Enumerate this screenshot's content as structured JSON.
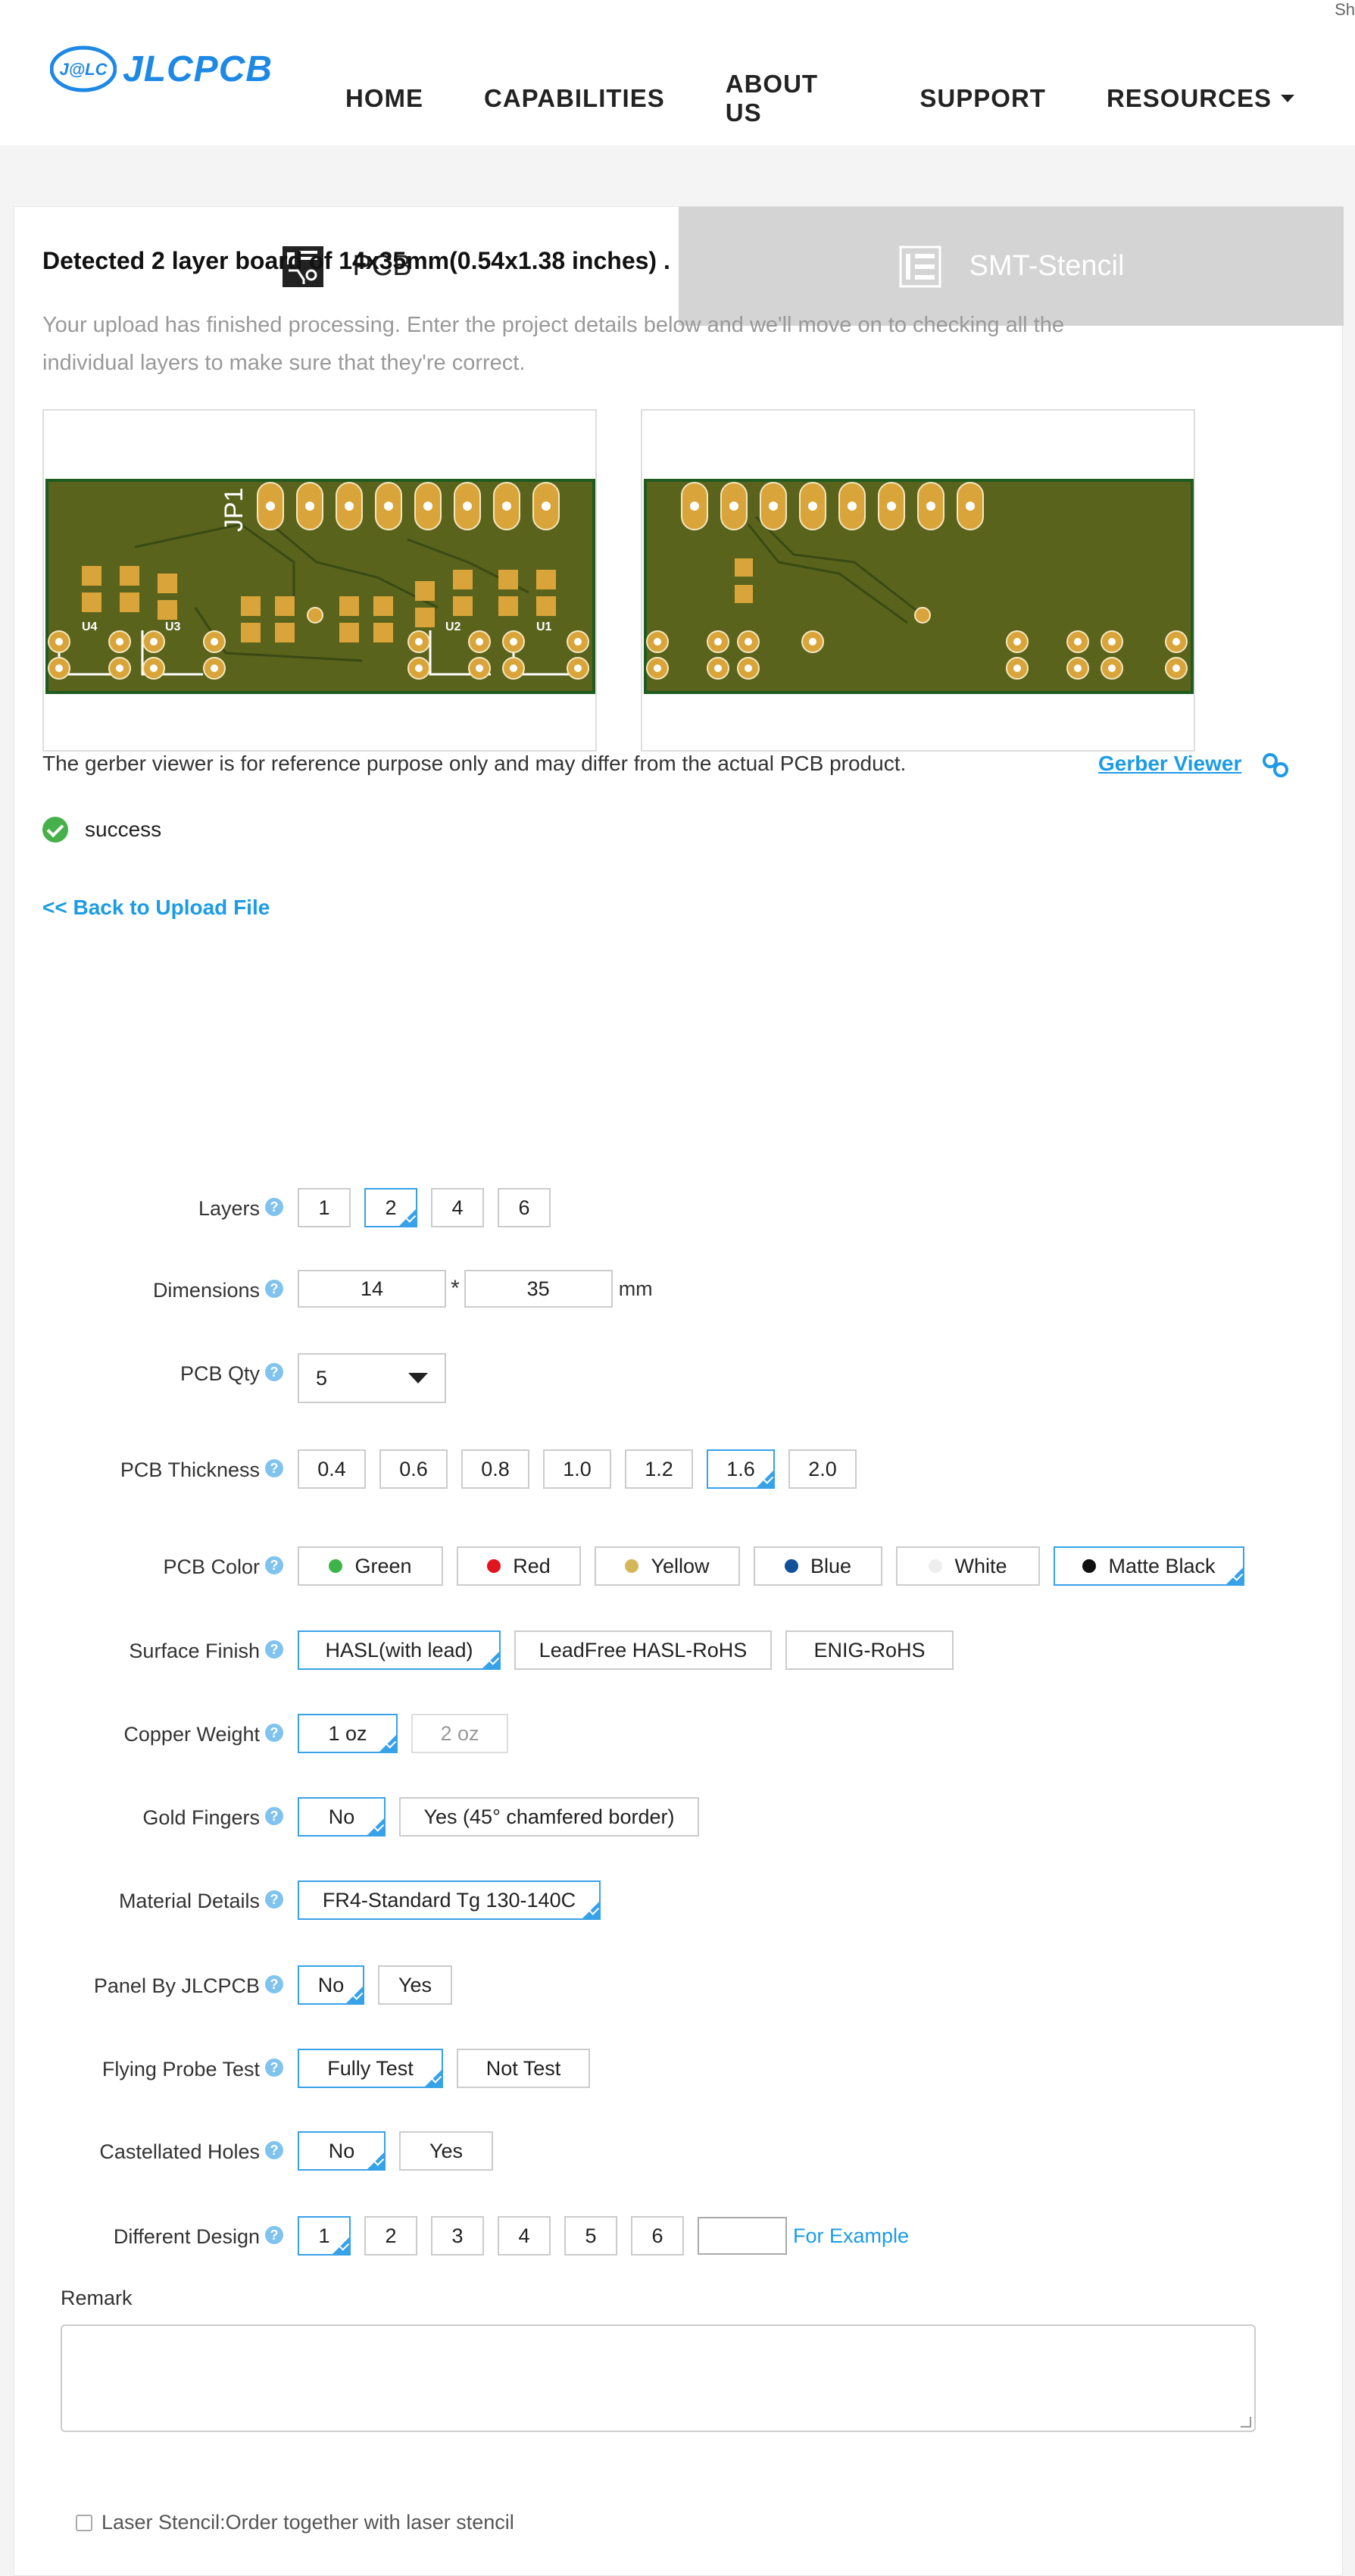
{
  "header": {
    "corner_text": "Sh",
    "logo_badge": "J@LC",
    "logo_word": "JLCPCB",
    "nav": [
      {
        "label": "HOME"
      },
      {
        "label": "CAPABILITIES"
      },
      {
        "label": "ABOUT US"
      },
      {
        "label": "SUPPORT"
      },
      {
        "label": "RESOURCES"
      }
    ]
  },
  "tabs": {
    "pcb": "PCB",
    "smt": "SMT-Stencil"
  },
  "upload": {
    "detected": "Detected 2 layer board of 14x35mm(0.54x1.38 inches) .",
    "description": "Your upload has finished processing. Enter the project details below and we'll move on to checking all the individual layers to make sure that they're correct.",
    "board_labels": {
      "jp": "JP1",
      "u1": "U1",
      "u2": "U2",
      "u3": "U3",
      "u4": "U4"
    },
    "disclaimer": "The gerber viewer is for reference purpose only and may differ from the actual PCB product.",
    "gerber_link": "Gerber Viewer",
    "status": "success",
    "back_link": "<< Back to Upload File"
  },
  "form": {
    "help_glyph": "?",
    "layers": {
      "label": "Layers",
      "options": [
        "1",
        "2",
        "4",
        "6"
      ],
      "selected": "2"
    },
    "dimensions": {
      "label": "Dimensions",
      "width": "14",
      "height": "35",
      "separator": "*",
      "unit": "mm"
    },
    "qty": {
      "label": "PCB Qty",
      "value": "5"
    },
    "thickness": {
      "label": "PCB Thickness",
      "options": [
        "0.4",
        "0.6",
        "0.8",
        "1.0",
        "1.2",
        "1.6",
        "2.0"
      ],
      "selected": "1.6"
    },
    "color": {
      "label": "PCB Color",
      "options": [
        {
          "name": "Green",
          "dot": "#3db44a"
        },
        {
          "name": "Red",
          "dot": "#e2141d"
        },
        {
          "name": "Yellow",
          "dot": "#d5b75a"
        },
        {
          "name": "Blue",
          "dot": "#12509a"
        },
        {
          "name": "White",
          "dot": "#eeeeee"
        },
        {
          "name": "Matte Black",
          "dot": "#111111"
        }
      ],
      "selected": "Matte Black"
    },
    "surface": {
      "label": "Surface Finish",
      "options": [
        "HASL(with lead)",
        "LeadFree HASL-RoHS",
        "ENIG-RoHS"
      ],
      "selected": "HASL(with lead)"
    },
    "copper": {
      "label": "Copper Weight",
      "options": [
        "1 oz",
        "2 oz"
      ],
      "selected": "1 oz",
      "disabled": "2 oz"
    },
    "gold": {
      "label": "Gold Fingers",
      "options": [
        "No",
        "Yes (45° chamfered border)"
      ],
      "selected": "No"
    },
    "material": {
      "label": "Material Details",
      "options": [
        "FR4-Standard Tg 130-140C"
      ],
      "selected": "FR4-Standard Tg 130-140C"
    },
    "panel": {
      "label": "Panel By JLCPCB",
      "options": [
        "No",
        "Yes"
      ],
      "selected": "No"
    },
    "probe": {
      "label": "Flying Probe Test",
      "options": [
        "Fully Test",
        "Not Test"
      ],
      "selected": "Fully Test"
    },
    "castellated": {
      "label": "Castellated Holes",
      "options": [
        "No",
        "Yes"
      ],
      "selected": "No"
    },
    "design": {
      "label": "Different Design",
      "options": [
        "1",
        "2",
        "3",
        "4",
        "5",
        "6"
      ],
      "selected": "1",
      "example_link": "For Example"
    },
    "remark": {
      "label": "Remark"
    },
    "laser": {
      "label": "Laser Stencil:Order together with laser stencil"
    }
  },
  "colors": {
    "accent": "#38a2e8",
    "link": "#1c9be6",
    "board": "#5a631c",
    "pad": "#d9a53a"
  }
}
